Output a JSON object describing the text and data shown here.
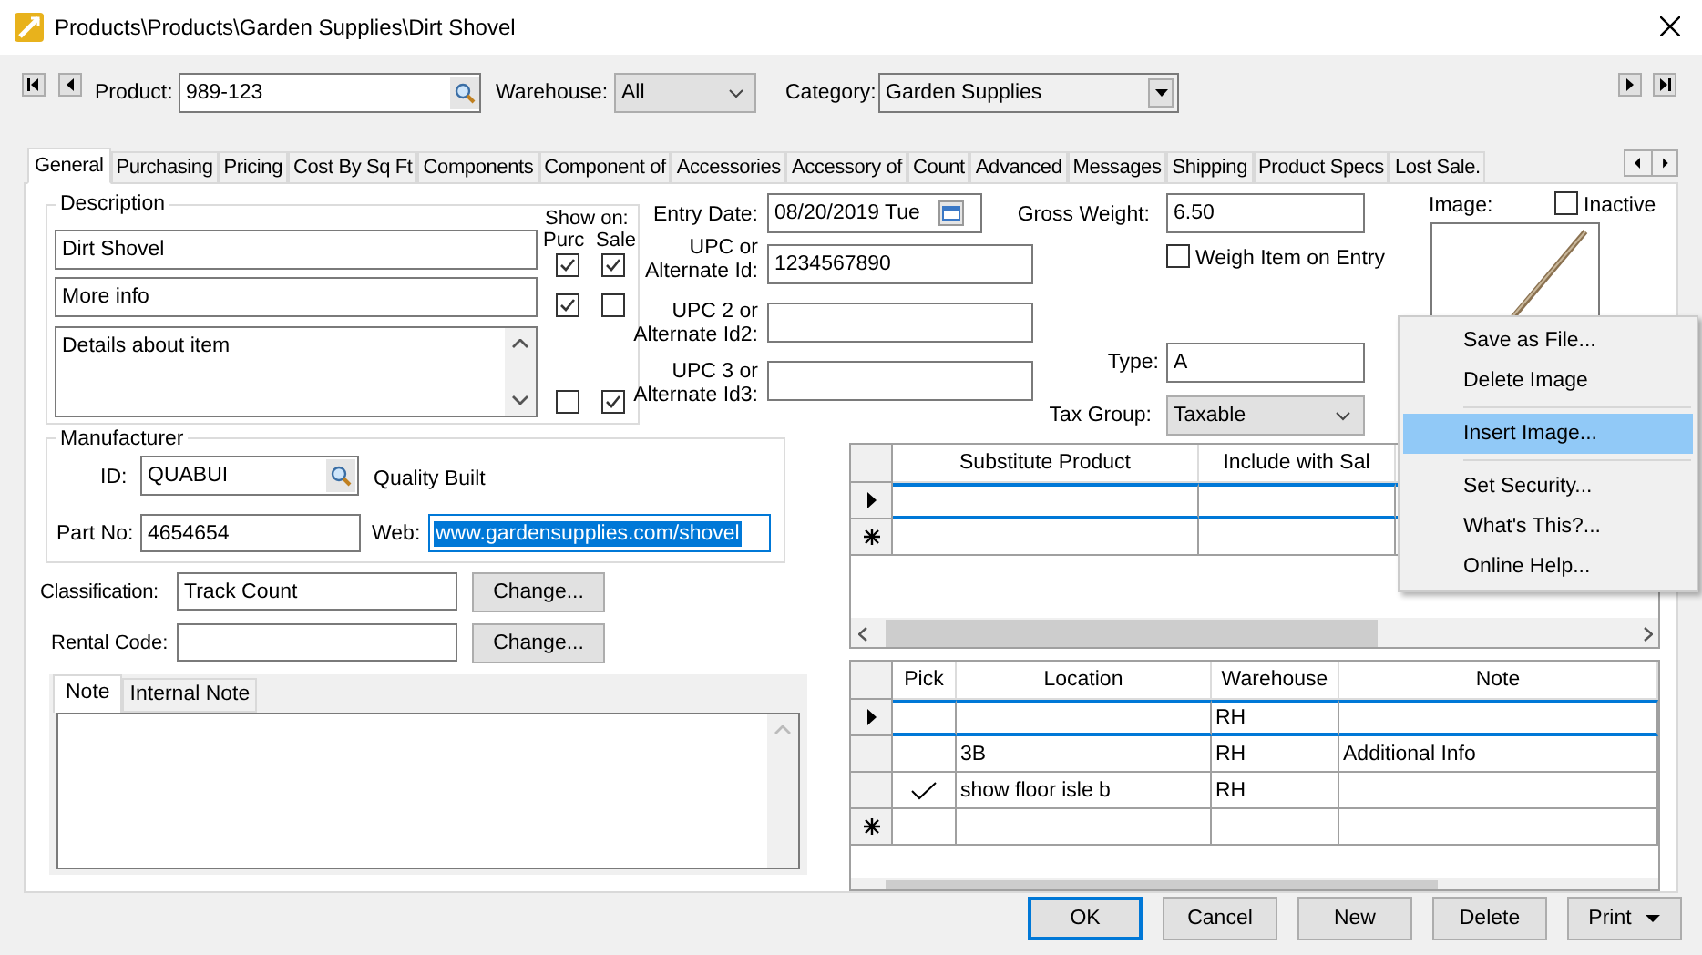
{
  "window": {
    "title": "Products\\Products\\Garden Supplies\\Dirt Shovel"
  },
  "product": {
    "label": "Product:",
    "value": "989-123"
  },
  "warehouse": {
    "label": "Warehouse:",
    "value": "All"
  },
  "category": {
    "label": "Category:",
    "value": "Garden Supplies"
  },
  "tabs": [
    {
      "label": "General",
      "selected": true
    },
    {
      "label": "Purchasing",
      "selected": false
    },
    {
      "label": "Pricing",
      "selected": false
    },
    {
      "label": "Cost By Sq Ft",
      "selected": false
    },
    {
      "label": "Components",
      "selected": false
    },
    {
      "label": "Component of",
      "selected": false
    },
    {
      "label": "Accessories",
      "selected": false
    },
    {
      "label": "Accessory of",
      "selected": false
    },
    {
      "label": "Count",
      "selected": false
    },
    {
      "label": "Advanced",
      "selected": false
    },
    {
      "label": "Messages",
      "selected": false
    },
    {
      "label": "Shipping",
      "selected": false
    },
    {
      "label": "Product Specs",
      "selected": false
    },
    {
      "label": "Lost Sale.",
      "selected": false
    }
  ],
  "description": {
    "title": "Description",
    "show_on": "Show on:",
    "columns": [
      "Purc",
      "Sale"
    ],
    "lines": [
      {
        "kind": "line",
        "value": "Dirt Shovel",
        "purc": true,
        "sale": true
      },
      {
        "kind": "line",
        "value": "More info",
        "purc": true,
        "sale": false
      },
      {
        "kind": "memo",
        "value": "Details about item",
        "purc": false,
        "sale": true
      }
    ]
  },
  "entry_date": {
    "label": "Entry Date:",
    "value": "08/20/2019 Tue"
  },
  "alternate_ids": [
    {
      "label_lines": [
        "UPC or",
        "Alternate Id:"
      ],
      "value": "1234567890"
    },
    {
      "label_lines": [
        "UPC 2 or",
        "Alternate Id2:"
      ]
    },
    {
      "label_lines": [
        "UPC 3 or",
        "Alternate Id3:"
      ]
    }
  ],
  "gross_weight": {
    "label": "Gross Weight:",
    "value": "6.50"
  },
  "weigh_item": {
    "label": "Weigh Item on Entry",
    "checked": false
  },
  "type": {
    "label": "Type:",
    "value": "A"
  },
  "tax_group": {
    "label": "Tax Group:",
    "value": "Taxable"
  },
  "image": {
    "label": "Image:"
  },
  "inactive": {
    "label": "Inactive",
    "checked": false
  },
  "manufacturer": {
    "title": "Manufacturer",
    "id_label": "ID:",
    "id": "QUABUI",
    "name": "Quality Built",
    "part_label": "Part No:",
    "part_no": "4654654",
    "web_label": "Web:",
    "web": "www.gardensupplies.com/shovel",
    "web_selected": true
  },
  "classification": {
    "label": "Classification:",
    "value": "Track Count",
    "button": "Change..."
  },
  "rental_code": {
    "label": "Rental Code:",
    "button": "Change..."
  },
  "note_tabs": [
    {
      "label": "Note",
      "selected": true
    },
    {
      "label": "Internal Note",
      "selected": false
    }
  ],
  "substitutes": {
    "columns": [
      "Substitute Product",
      "Include with Sal"
    ],
    "rows": [
      {
        "kind": "current",
        "selected": true
      },
      {
        "kind": "new",
        "selected": false
      }
    ]
  },
  "locations": {
    "columns": [
      "Pick",
      "Location",
      "Warehouse",
      "Note"
    ],
    "rows": [
      {
        "kind": "current",
        "selected": true,
        "picked": false,
        "warehouse": "RH"
      },
      {
        "kind": "record",
        "selected": false,
        "picked": false,
        "location": "3B",
        "warehouse": "RH",
        "note": "Additional Info"
      },
      {
        "kind": "record",
        "selected": false,
        "picked": true,
        "location": "show floor isle b",
        "warehouse": "RH"
      },
      {
        "kind": "new",
        "selected": false,
        "picked": false
      }
    ]
  },
  "context_menu": {
    "groups": [
      [
        {
          "label": "Save as File...",
          "selected": false
        },
        {
          "label": "Delete Image",
          "selected": false
        }
      ],
      [
        {
          "label": "Insert Image...",
          "selected": true
        }
      ],
      [
        {
          "label": "Set Security...",
          "selected": false
        },
        {
          "label": "What's This?...",
          "selected": false
        },
        {
          "label": "Online Help...",
          "selected": false
        }
      ]
    ]
  },
  "buttons": [
    {
      "label": "OK",
      "kind": "default"
    },
    {
      "label": "Cancel",
      "kind": "normal"
    },
    {
      "label": "New",
      "kind": "normal"
    },
    {
      "label": "Delete",
      "kind": "normal"
    },
    {
      "label": "Print",
      "kind": "dropdown"
    }
  ]
}
